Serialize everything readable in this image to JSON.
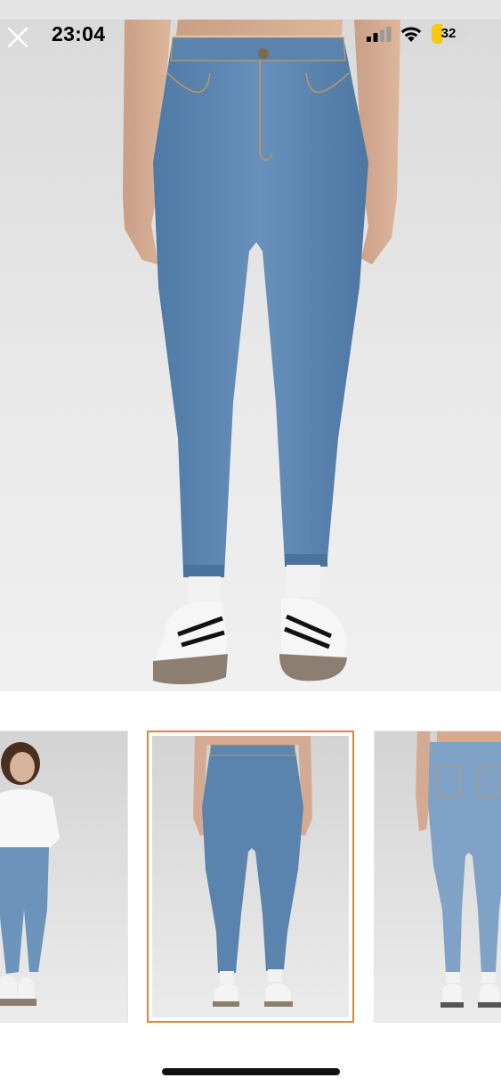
{
  "status_bar": {
    "time": "23:04",
    "battery_percent": 32,
    "battery_label": "32",
    "battery_color": "#f6c90e",
    "icons": [
      "signal-icon",
      "wifi-icon",
      "battery-icon"
    ]
  },
  "hero": {
    "close_icon": "close-icon",
    "background": "#e4e4e4",
    "denim_color": "#5b84ad"
  },
  "gallery": {
    "thumbnails": [
      {
        "view": "model-full-front-white-tshirt",
        "selected": false
      },
      {
        "view": "model-front-jeans",
        "selected": true
      },
      {
        "view": "model-back-jeans",
        "selected": false
      }
    ],
    "selected_index": 1,
    "selected_border_color": "#d78a3c"
  }
}
